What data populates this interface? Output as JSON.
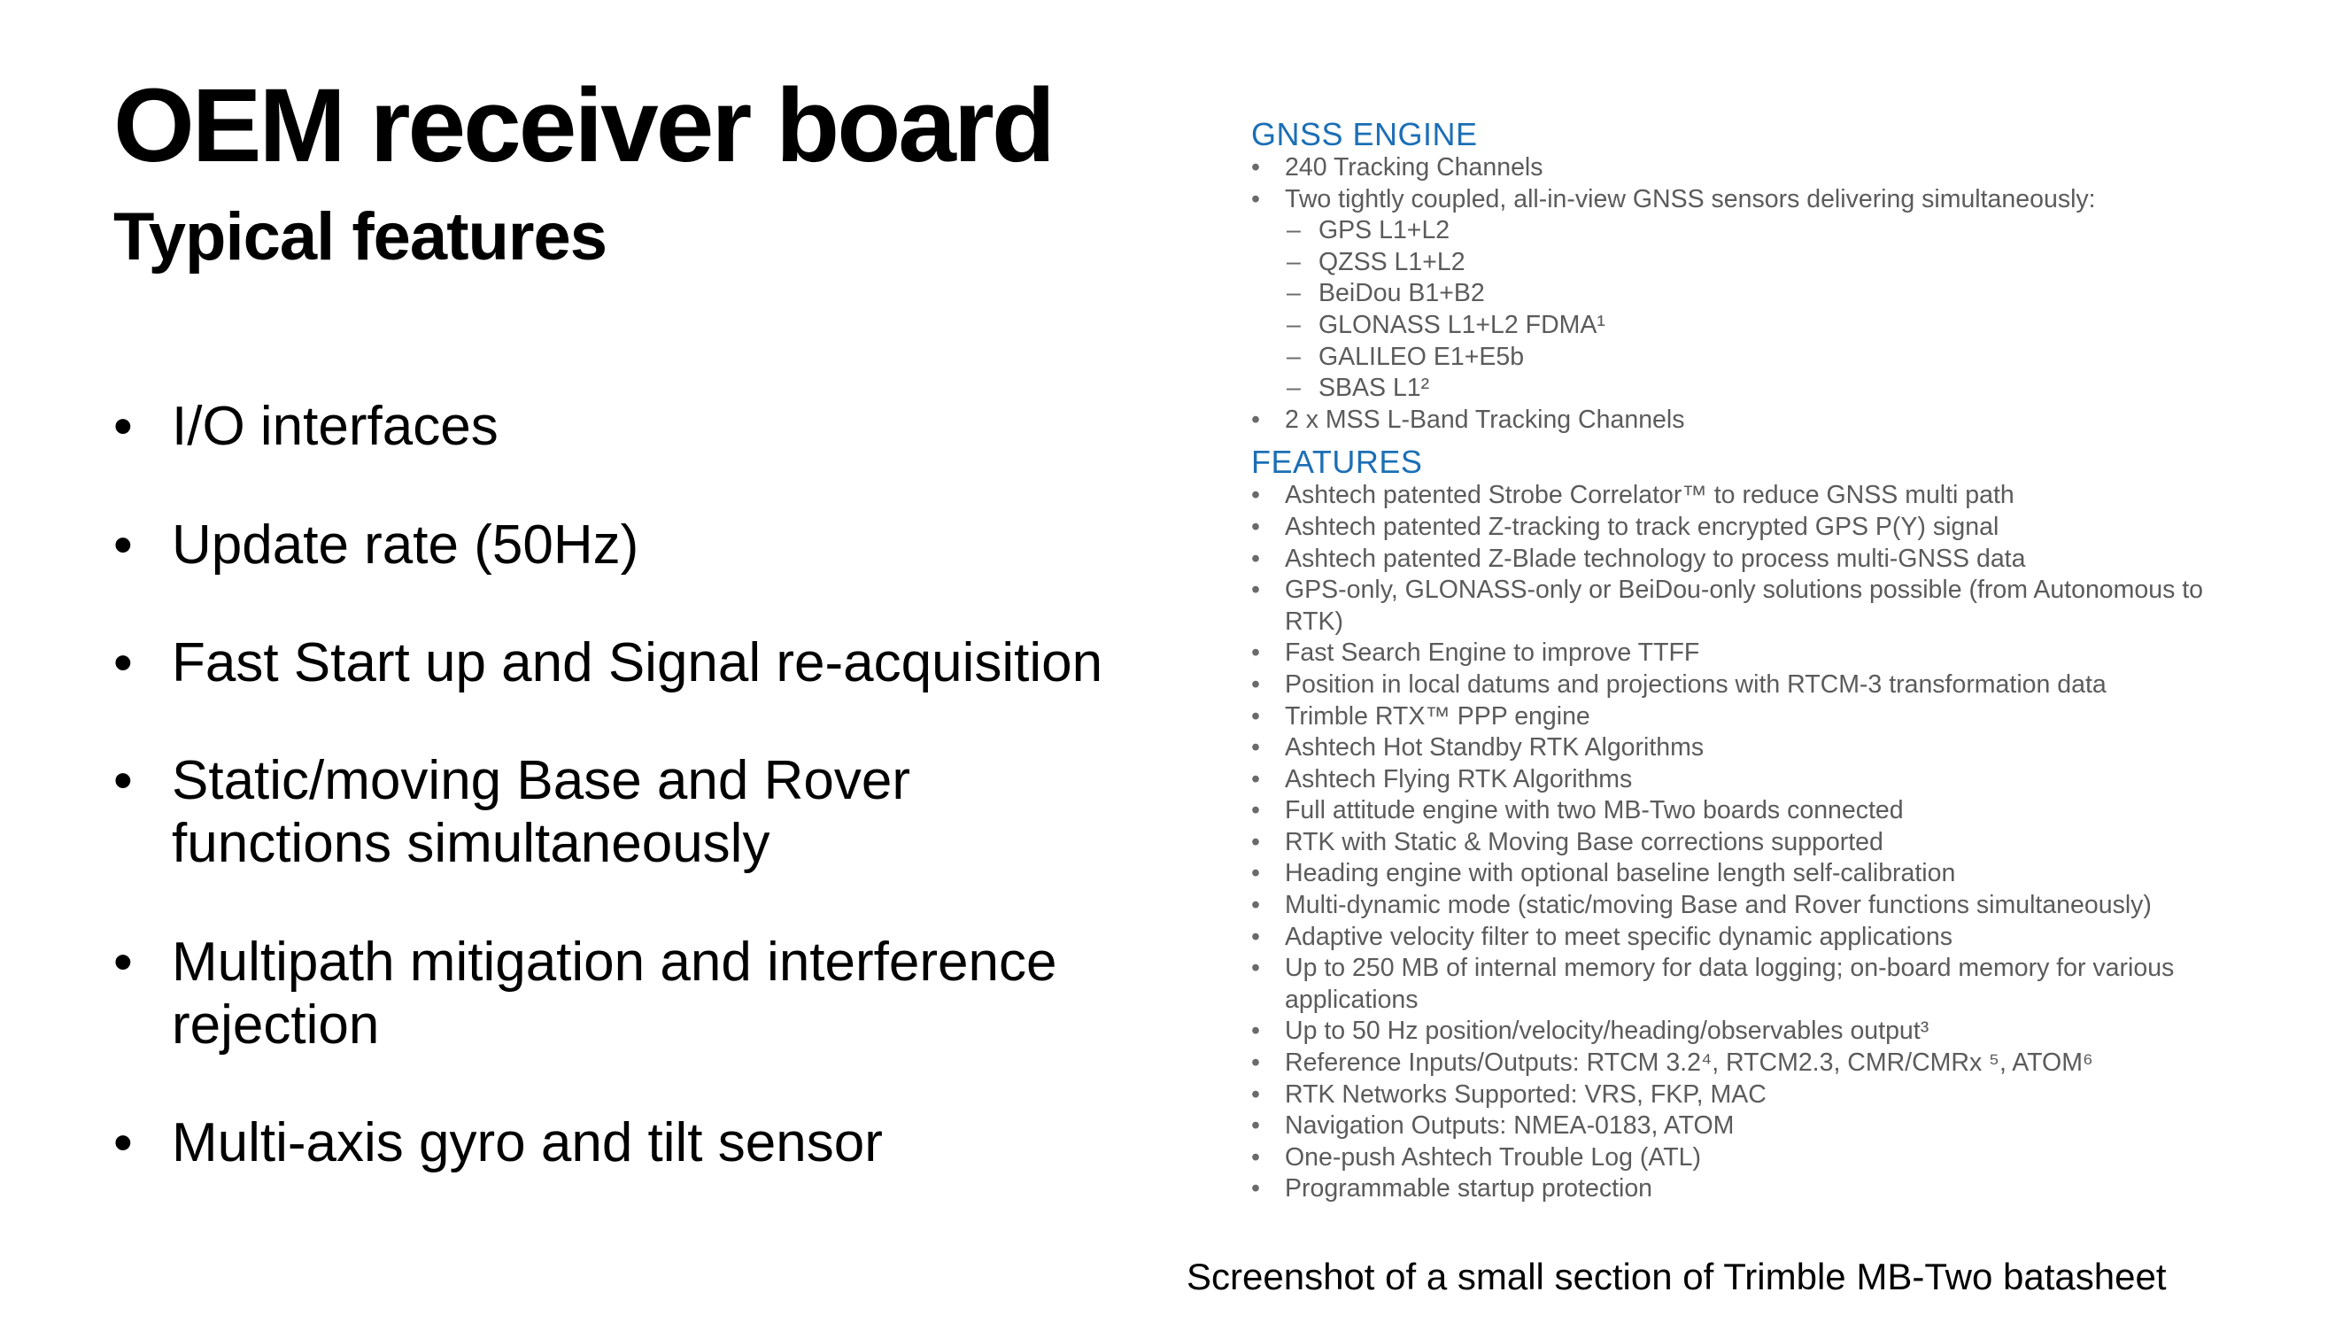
{
  "slide": {
    "title": "OEM receiver board",
    "subtitle": "Typical features",
    "bullet_marker": "•",
    "bullets": [
      "I/O interfaces",
      "Update rate (50Hz)",
      "Fast Start up and Signal re-acquisition",
      "Static/moving Base and Rover functions simultaneously",
      "Multipath mitigation and interference rejection",
      "Multi-axis gyro and tilt sensor"
    ],
    "caption": "Screenshot of a small section of Trimble MB-Two batasheet"
  },
  "datasheet": {
    "bullet_marker": "•",
    "dash_marker": "–",
    "gnss_engine": {
      "heading": "GNSS ENGINE",
      "items": [
        "240 Tracking Channels",
        "Two tightly coupled, all-in-view GNSS sensors delivering simultaneously:"
      ],
      "subitems": [
        "GPS L1+L2",
        "QZSS L1+L2",
        "BeiDou B1+B2",
        "GLONASS L1+L2 FDMA¹",
        "GALILEO E1+E5b",
        "SBAS L1²"
      ],
      "last_item": "2 x MSS L-Band Tracking Channels"
    },
    "features": {
      "heading": "FEATURES",
      "items": [
        "Ashtech patented Strobe Correlator™ to reduce GNSS multi path",
        "Ashtech patented Z-tracking to track encrypted GPS P(Y) signal",
        "Ashtech patented Z-Blade technology to process multi-GNSS data",
        "GPS-only, GLONASS-only or BeiDou-only solutions possible (from Autonomous to RTK)",
        "Fast Search Engine to improve TTFF",
        "Position in local datums and projections with RTCM-3 transformation data",
        "Trimble RTX™ PPP engine",
        "Ashtech Hot Standby RTK Algorithms",
        "Ashtech Flying RTK Algorithms",
        "Full attitude engine with two MB-Two boards connected",
        "RTK with Static & Moving Base corrections supported",
        "Heading engine with optional baseline length self-calibration",
        "Multi-dynamic mode (static/moving Base and Rover functions simultaneously)",
        "Adaptive velocity filter to meet specific dynamic applications",
        "Up to 250 MB of internal memory for data logging; on-board memory for various applications",
        "Up to 50 Hz position/velocity/heading/observables output³",
        "Reference Inputs/Outputs: RTCM 3.2⁴, RTCM2.3, CMR/CMRx ⁵, ATOM⁶",
        "RTK Networks Supported: VRS, FKP, MAC",
        "Navigation Outputs: NMEA-0183, ATOM",
        "One-push Ashtech Trouble Log (ATL)",
        "Programmable startup protection"
      ]
    }
  }
}
